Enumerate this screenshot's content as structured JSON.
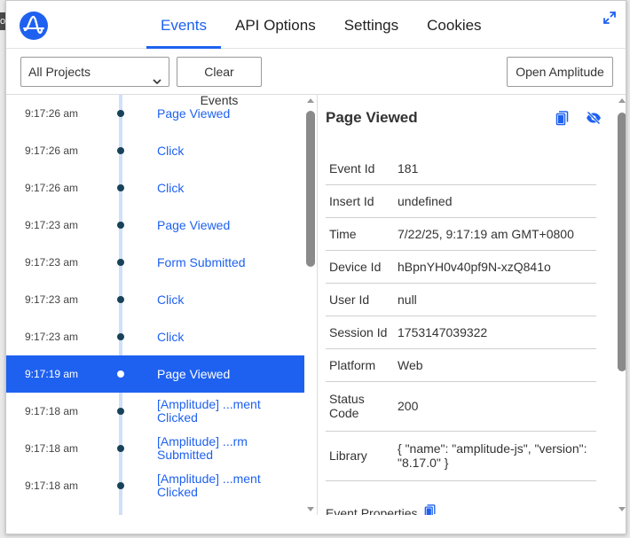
{
  "background": {
    "edge_char": "o"
  },
  "header": {
    "tabs": [
      {
        "label": "Events",
        "active": true
      },
      {
        "label": "API Options",
        "active": false
      },
      {
        "label": "Settings",
        "active": false
      },
      {
        "label": "Cookies",
        "active": false
      }
    ],
    "logo_icon": "amplitude-logo",
    "expand_icon": "expand-icon"
  },
  "toolbar": {
    "project_select": "All Projects",
    "clear_label": "Clear Events",
    "open_label": "Open Amplitude"
  },
  "events": [
    {
      "time": "9:17:26 am",
      "name": "Page Viewed"
    },
    {
      "time": "9:17:26 am",
      "name": "Click"
    },
    {
      "time": "9:17:26 am",
      "name": "Click"
    },
    {
      "time": "9:17:23 am",
      "name": "Page Viewed"
    },
    {
      "time": "9:17:23 am",
      "name": "Form Submitted"
    },
    {
      "time": "9:17:23 am",
      "name": "Click"
    },
    {
      "time": "9:17:23 am",
      "name": "Click"
    },
    {
      "time": "9:17:19 am",
      "name": "Page Viewed",
      "selected": true
    },
    {
      "time": "9:17:18 am",
      "name": "[Amplitude] ...ment Clicked"
    },
    {
      "time": "9:17:18 am",
      "name": "[Amplitude] ...rm Submitted"
    },
    {
      "time": "9:17:18 am",
      "name": "[Amplitude] ...ment Clicked"
    },
    {
      "time": "",
      "name": "[Amplitude] ...ment"
    }
  ],
  "detail": {
    "title": "Page Viewed",
    "props": [
      {
        "key": "Event Id",
        "value": "181"
      },
      {
        "key": "Insert Id",
        "value": "undefined"
      },
      {
        "key": "Time",
        "value": "7/22/25, 9:17:19 am GMT+0800"
      },
      {
        "key": "Device Id",
        "value": "hBpnYH0v40pf9N-xzQ841o"
      },
      {
        "key": "User Id",
        "value": "null"
      },
      {
        "key": "Session Id",
        "value": "1753147039322"
      },
      {
        "key": "Platform",
        "value": "Web"
      },
      {
        "key": "Status Code",
        "value": "200"
      },
      {
        "key": "Library",
        "value": "{ \"name\": \"amplitude-js\", \"version\": \"8.17.0\" }"
      }
    ],
    "event_properties_label": "Event Properties"
  },
  "colors": {
    "accent": "#1e61f0",
    "dot": "#17425a",
    "timeline": "#cfe0fb"
  }
}
